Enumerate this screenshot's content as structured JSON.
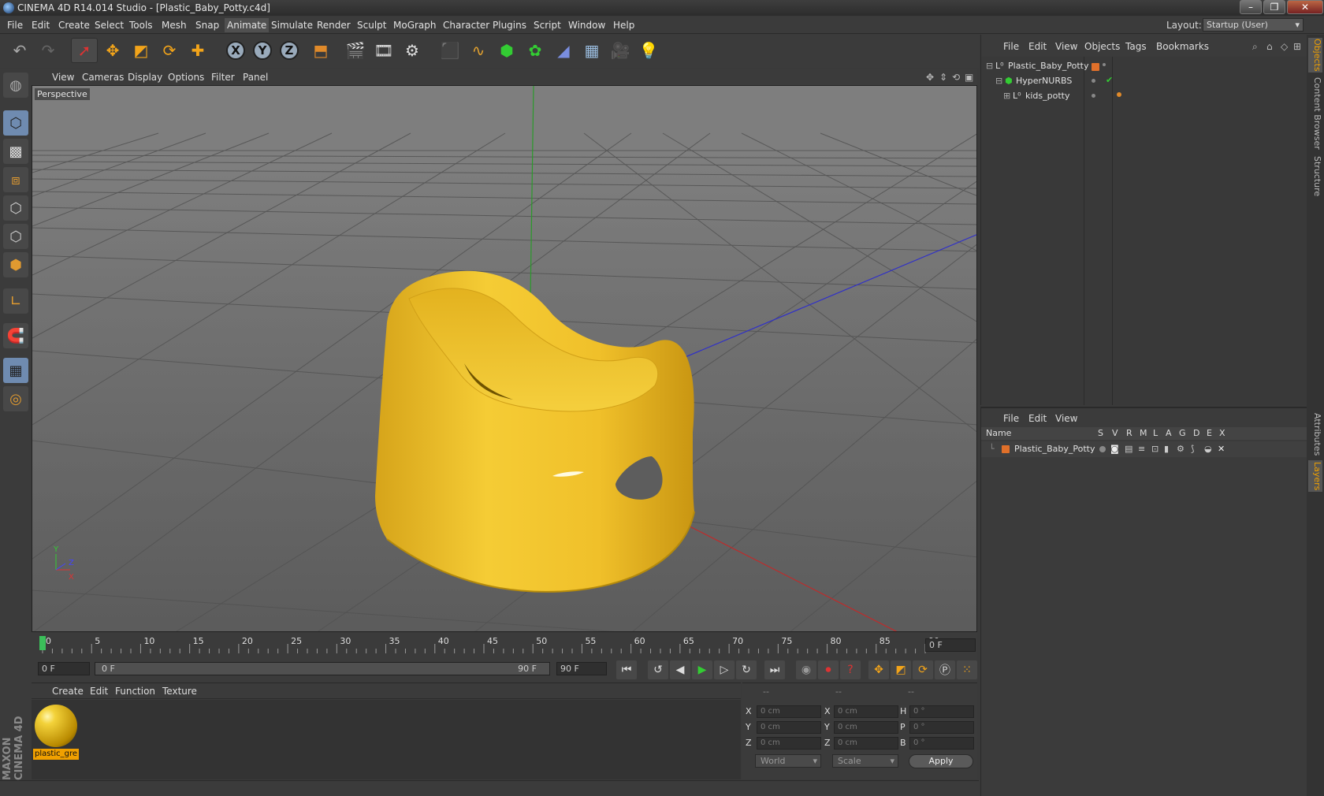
{
  "window": {
    "title": "CINEMA 4D R14.014 Studio - [Plastic_Baby_Potty.c4d]",
    "controls": [
      "–",
      "❐",
      "✕"
    ]
  },
  "menubar": {
    "items": [
      "File",
      "Edit",
      "Create",
      "Select",
      "Tools",
      "Mesh",
      "Snap",
      "Animate",
      "Simulate",
      "Render",
      "Sculpt",
      "MoGraph",
      "Character",
      "Plugins",
      "Script",
      "Window",
      "Help"
    ],
    "active": "Animate",
    "layout_label": "Layout:",
    "layout_value": "Startup (User)"
  },
  "viewport": {
    "menu": [
      "View",
      "Cameras",
      "Display",
      "Options",
      "Filter",
      "Panel"
    ],
    "label": "Perspective",
    "object_color": "#f2c12a"
  },
  "timeline": {
    "ticks": [
      "0",
      "5",
      "10",
      "15",
      "20",
      "25",
      "30",
      "35",
      "40",
      "45",
      "50",
      "55",
      "60",
      "65",
      "70",
      "75",
      "80",
      "85",
      "90"
    ],
    "current_frame": "0 F",
    "start_field": "0 F",
    "range_start": "0 F",
    "range_end": "90 F",
    "end_field": "90 F"
  },
  "material_manager": {
    "menu": [
      "Create",
      "Edit",
      "Function",
      "Texture"
    ],
    "material_name": "plastic_gre"
  },
  "coordinates": {
    "headers": [
      "--",
      "--",
      "--"
    ],
    "rows": [
      {
        "l1": "X",
        "v1": "0 cm",
        "l2": "X",
        "v2": "0 cm",
        "l3": "H",
        "v3": "0 °"
      },
      {
        "l1": "Y",
        "v1": "0 cm",
        "l2": "Y",
        "v2": "0 cm",
        "l3": "P",
        "v3": "0 °"
      },
      {
        "l1": "Z",
        "v1": "0 cm",
        "l2": "Z",
        "v2": "0 cm",
        "l3": "B",
        "v3": "0 °"
      }
    ],
    "space": "World",
    "mode": "Scale",
    "apply": "Apply"
  },
  "object_manager": {
    "menu": [
      "File",
      "Edit",
      "View",
      "Objects",
      "Tags",
      "Bookmarks"
    ],
    "objects": [
      {
        "name": "Plastic_Baby_Potty",
        "depth": 0
      },
      {
        "name": "HyperNURBS",
        "depth": 1
      },
      {
        "name": "kids_potty",
        "depth": 2
      }
    ]
  },
  "layer_manager": {
    "menu": [
      "File",
      "Edit",
      "View"
    ],
    "columns": [
      "Name",
      "S",
      "V",
      "R",
      "M",
      "L",
      "A",
      "G",
      "D",
      "E",
      "X"
    ],
    "layers": [
      {
        "name": "Plastic_Baby_Potty",
        "color": "#e0702a"
      }
    ]
  },
  "right_tabs": [
    "Objects",
    "Content Browser",
    "Structure",
    "Attributes",
    "Layers"
  ],
  "branding": {
    "logo": "MAXON CINEMA 4D"
  }
}
